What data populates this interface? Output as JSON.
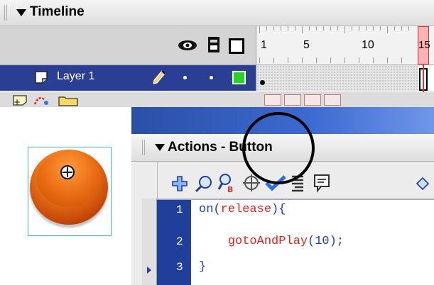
{
  "timeline": {
    "title": "Timeline",
    "ruler_labels": [
      "1",
      "5",
      "10"
    ],
    "playhead_frame": "15",
    "layer": {
      "name": "Layer 1",
      "color": "#27d32b"
    }
  },
  "actions_panel": {
    "title": "Actions - Button",
    "code_lines": [
      {
        "num": "1",
        "parts": [
          {
            "t": "on(",
            "c": "kw"
          },
          {
            "t": "release",
            "c": "red"
          },
          {
            "t": "){",
            "c": "kw"
          }
        ]
      },
      {
        "num": "2",
        "parts": [
          {
            "t": "    ",
            "c": "kw"
          },
          {
            "t": "gotoAndPlay",
            "c": "red"
          },
          {
            "t": "(10);",
            "c": "kw"
          }
        ]
      },
      {
        "num": "3",
        "parts": [
          {
            "t": "}",
            "c": "kw"
          }
        ]
      }
    ]
  },
  "icons": {
    "timeline": [
      "eye-icon",
      "lock-icon",
      "outline-square-icon",
      "pencil-icon",
      "add-layer-icon",
      "add-motion-guide-icon",
      "insert-folder-icon"
    ],
    "actions_toolbar": [
      "add-statement-icon",
      "find-icon",
      "replace-icon",
      "target-path-icon",
      "check-syntax-icon",
      "auto-format-icon",
      "code-hint-icon",
      "debug-options-icon"
    ]
  },
  "colors": {
    "accent_blue": "#2a3f93",
    "button_orange": "#f07a1a",
    "code_red": "#e02020",
    "selection_blue": "#3fb2e8"
  }
}
